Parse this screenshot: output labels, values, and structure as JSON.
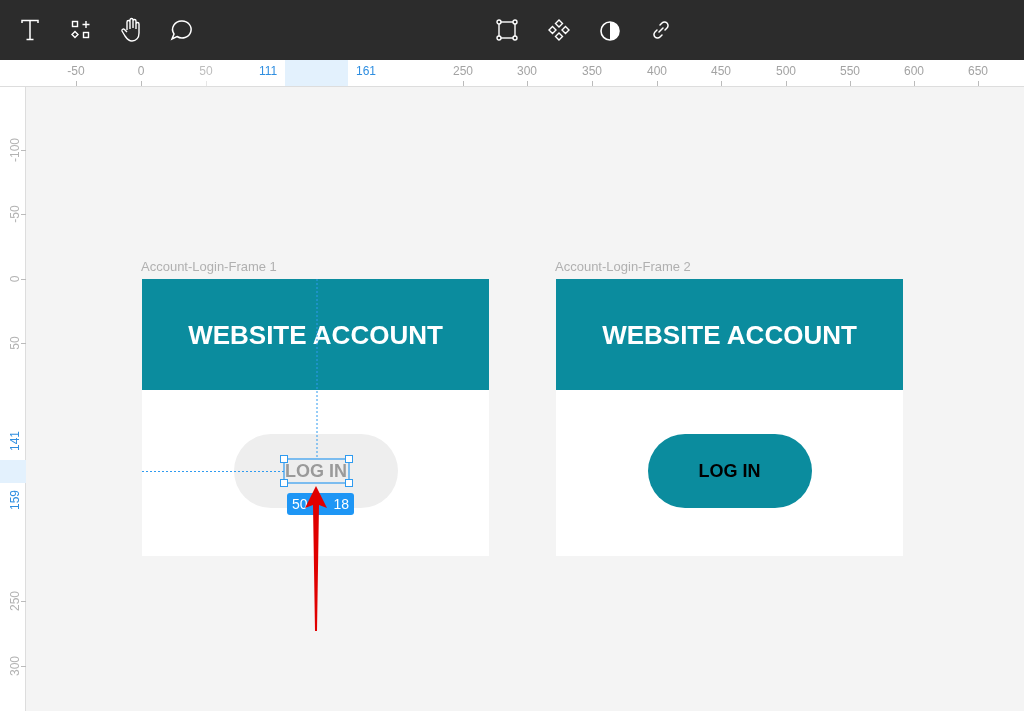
{
  "ruler_top": {
    "labels": [
      {
        "text": "-50",
        "selected": false,
        "faded": false
      },
      {
        "text": "0",
        "selected": false,
        "faded": false
      },
      {
        "text": "50",
        "selected": false,
        "faded": true
      },
      {
        "text": "111",
        "selected": true,
        "faded": false
      },
      {
        "text": "161",
        "selected": true,
        "faded": false
      },
      {
        "text": "250",
        "selected": false,
        "faded": false
      },
      {
        "text": "300",
        "selected": false,
        "faded": false
      },
      {
        "text": "350",
        "selected": false,
        "faded": false
      },
      {
        "text": "400",
        "selected": false,
        "faded": false
      },
      {
        "text": "450",
        "selected": false,
        "faded": false
      },
      {
        "text": "500",
        "selected": false,
        "faded": false
      },
      {
        "text": "550",
        "selected": false,
        "faded": false
      },
      {
        "text": "600",
        "selected": false,
        "faded": false
      },
      {
        "text": "650",
        "selected": false,
        "faded": false
      }
    ]
  },
  "ruler_left": {
    "labels": [
      {
        "text": "-100",
        "selected": false
      },
      {
        "text": "-50",
        "selected": false
      },
      {
        "text": "0",
        "selected": false
      },
      {
        "text": "50",
        "selected": false
      },
      {
        "text": "141",
        "selected": true
      },
      {
        "text": "159",
        "selected": true
      },
      {
        "text": "250",
        "selected": false
      },
      {
        "text": "300",
        "selected": false
      }
    ]
  },
  "frames": [
    {
      "label": "Account-Login-Frame 1",
      "header": "WEBSITE ACCOUNT",
      "button": "LOG IN",
      "selected": true,
      "size_badge": [
        "50",
        "18"
      ]
    },
    {
      "label": "Account-Login-Frame 2",
      "header": "WEBSITE ACCOUNT",
      "button": "LOG IN",
      "selected": false
    }
  ]
}
